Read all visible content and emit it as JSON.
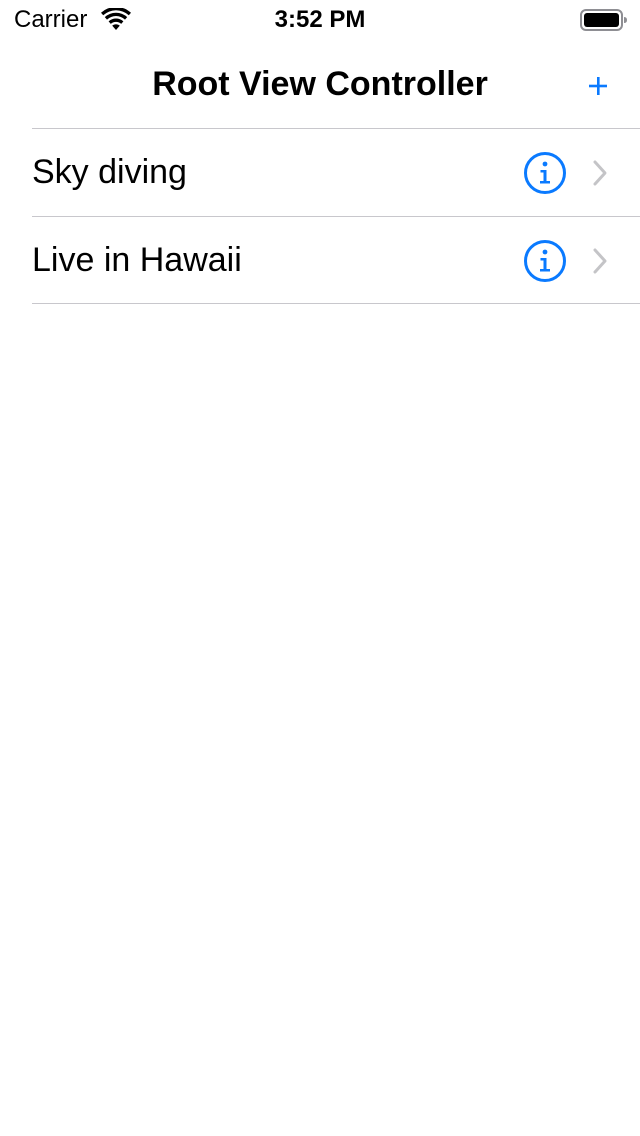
{
  "status_bar": {
    "carrier": "Carrier",
    "time": "3:52 PM",
    "wifi_icon": "wifi-icon",
    "battery_icon": "battery-full-icon"
  },
  "nav_bar": {
    "title": "Root View Controller",
    "add_icon": "plus-icon"
  },
  "table": {
    "rows": [
      {
        "label": "Sky diving",
        "info_icon": "info-circle-icon",
        "accessory_icon": "chevron-right-icon"
      },
      {
        "label": "Live in Hawaii",
        "info_icon": "info-circle-icon",
        "accessory_icon": "chevron-right-icon"
      }
    ]
  },
  "colors": {
    "tint": "#0a7aff",
    "separator": "#c8c7cc",
    "chevron": "#c4c4c7"
  }
}
